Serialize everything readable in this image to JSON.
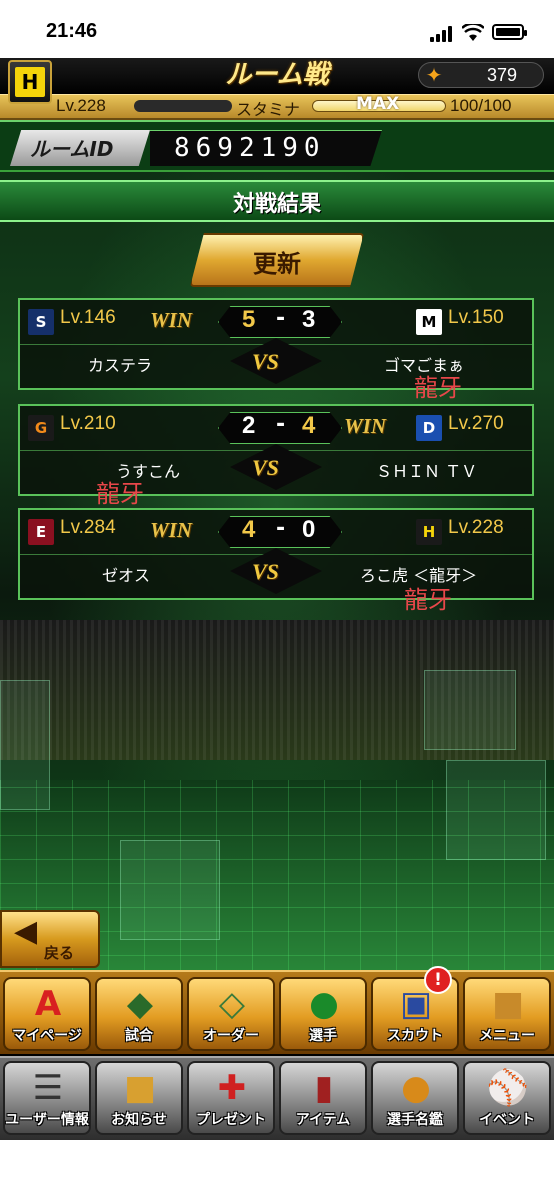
{
  "status_bar": {
    "time": "21:46"
  },
  "header": {
    "title": "ルーム戦",
    "coins": "379",
    "level_label": "Lv.228",
    "stamina_label": "スタミナ",
    "stamina_max_label": "MAX",
    "stamina_value": "100/100",
    "stamina_level": 1.0,
    "team_logo_glyph": "H"
  },
  "room": {
    "label": "ルームID",
    "id": "8692190"
  },
  "results": {
    "title": "対戦結果",
    "refresh_label": "更新",
    "win_label": "WIN",
    "vs_label": "VS",
    "dash": "-",
    "matches": [
      {
        "left": {
          "logo": "S",
          "logo_icon": "swallows-logo-icon",
          "level": "Lv.146",
          "name": "カステラ",
          "win": true,
          "score": "5"
        },
        "right": {
          "logo": "M",
          "logo_icon": "marines-logo-icon",
          "level": "Lv.150",
          "name": "ゴマごまぁ",
          "win": false,
          "score": "3"
        },
        "note": "龍牙"
      },
      {
        "left": {
          "logo": "G",
          "logo_icon": "giants-logo-icon",
          "level": "Lv.210",
          "name": "うすこん",
          "win": false,
          "score": "2"
        },
        "right": {
          "logo": "D",
          "logo_icon": "dragons-logo-icon",
          "level": "Lv.270",
          "name": "ＳＨＩＮ ＴＶ",
          "win": true,
          "score": "4"
        },
        "note": "龍牙"
      },
      {
        "left": {
          "logo": "E",
          "logo_icon": "eagles-logo-icon",
          "level": "Lv.284",
          "name": "ゼオス",
          "win": true,
          "score": "4"
        },
        "right": {
          "logo": "H",
          "logo_icon": "tigers-logo-icon",
          "level": "Lv.228",
          "name": "ろこ虎 ＜龍牙＞",
          "win": false,
          "score": "0"
        },
        "note": "龍牙"
      }
    ]
  },
  "nav": {
    "back_label": "戻る",
    "row1": [
      {
        "label": "マイページ",
        "icon": "mypage-icon"
      },
      {
        "label": "試合",
        "icon": "stadium-icon"
      },
      {
        "label": "オーダー",
        "icon": "order-icon"
      },
      {
        "label": "選手",
        "icon": "player-icon"
      },
      {
        "label": "スカウト",
        "icon": "scout-icon",
        "badge": "!"
      },
      {
        "label": "メニュー",
        "icon": "menu-icon"
      }
    ],
    "row2": [
      {
        "label": "ユーザー情報",
        "icon": "user-info-icon"
      },
      {
        "label": "お知らせ",
        "icon": "notice-icon"
      },
      {
        "label": "プレゼント",
        "icon": "present-icon"
      },
      {
        "label": "アイテム",
        "icon": "item-icon"
      },
      {
        "label": "選手名鑑",
        "icon": "player-directory-icon"
      },
      {
        "label": "イベント",
        "icon": "event-icon"
      }
    ]
  },
  "colors": {
    "win_gold": "#e8c24a",
    "score_gold": "#f2c84a",
    "frame_green": "#5ac25a",
    "note_red": "#e8474a"
  }
}
